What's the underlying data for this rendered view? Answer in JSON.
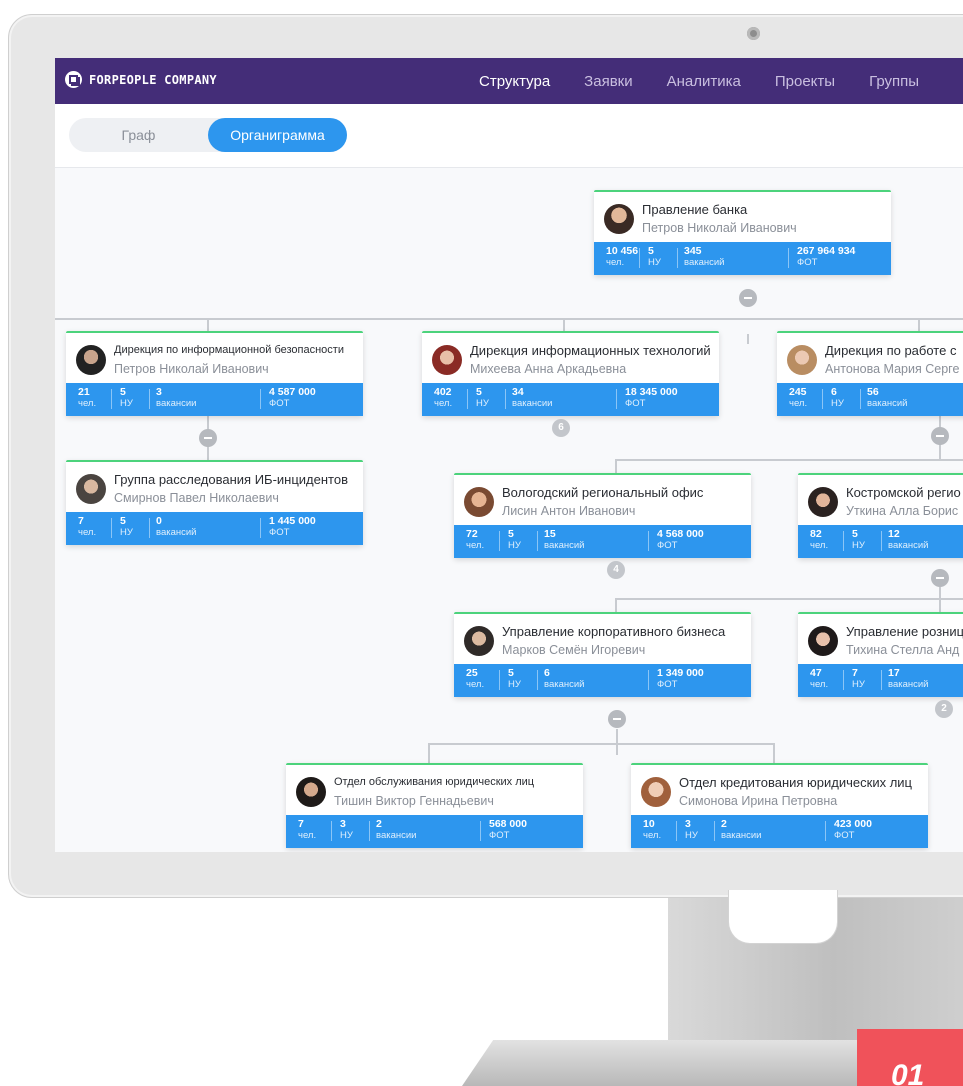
{
  "app": {
    "logo_text": "FORPEOPLE COMPANY",
    "nav": [
      "Структура",
      "Заявки",
      "Аналитика",
      "Проекты",
      "Группы"
    ],
    "active_nav": "Структура",
    "view_toggle": [
      "Граф",
      "Органиграмма"
    ],
    "active_view": "Органиграмма"
  },
  "stat_labels": {
    "people": "чел.",
    "nu": "НУ",
    "vacancies": "вакансий",
    "vacancies_alt": "вакансии",
    "payroll": "ФОТ"
  },
  "units": [
    {
      "name": "Правление банка",
      "person": "Петров Николай Иванович",
      "people": "10 456",
      "nu": "5",
      "vacancies": "345",
      "vac_label": "вакансий",
      "payroll": "267 964 934"
    },
    {
      "name": "Дирекция по информационной безопасности",
      "person": "Петров Николай Иванович",
      "people": "21",
      "nu": "5",
      "vacancies": "3",
      "vac_label": "вакансии",
      "payroll": "4 587 000"
    },
    {
      "name": "Дирекция информационных технологий",
      "person": "Михеева Анна Аркадьевна",
      "people": "402",
      "nu": "5",
      "vacancies": "34",
      "vac_label": "вакансии",
      "payroll": "18 345 000",
      "collapsed_children": "6"
    },
    {
      "name": "Дирекция по работе с",
      "person": "Антонова Мария Серге",
      "people": "245",
      "nu": "6",
      "vacancies": "56",
      "vac_label": "вакансий",
      "payroll": ""
    },
    {
      "name": "Группа расследования ИБ-инцидентов",
      "person": "Смирнов Павел Николаевич",
      "people": "7",
      "nu": "5",
      "vacancies": "0",
      "vac_label": "вакансий",
      "payroll": "1 445 000"
    },
    {
      "name": "Вологодский региональный офис",
      "person": "Лисин Антон Иванович",
      "people": "72",
      "nu": "5",
      "vacancies": "15",
      "vac_label": "вакансий",
      "payroll": "4 568 000",
      "collapsed_children": "4"
    },
    {
      "name": "Костромской регио",
      "person": "Уткина Алла Борис",
      "people": "82",
      "nu": "5",
      "vacancies": "12",
      "vac_label": "вакансий",
      "payroll": ""
    },
    {
      "name": "Управление корпоративного бизнеса",
      "person": "Марков Семён Игоревич",
      "people": "25",
      "nu": "5",
      "vacancies": "6",
      "vac_label": "вакансий",
      "payroll": "1 349 000"
    },
    {
      "name": "Управление розниц",
      "person": "Тихина Стелла Анд",
      "people": "47",
      "nu": "7",
      "vacancies": "17",
      "vac_label": "вакансий",
      "payroll": "",
      "collapsed_children": "2"
    },
    {
      "name": "Отдел обслуживания юридических лиц",
      "person": "Тишин Виктор Геннадьевич",
      "people": "7",
      "nu": "3",
      "vacancies": "2",
      "vac_label": "вакансии",
      "payroll": "568 000"
    },
    {
      "name": "Отдел кредитования юридических лиц",
      "person": "Симонова Ирина Петровна",
      "people": "10",
      "nu": "3",
      "vacancies": "2",
      "vac_label": "вакансии",
      "payroll": "423 000"
    }
  ],
  "badge_text": "01"
}
